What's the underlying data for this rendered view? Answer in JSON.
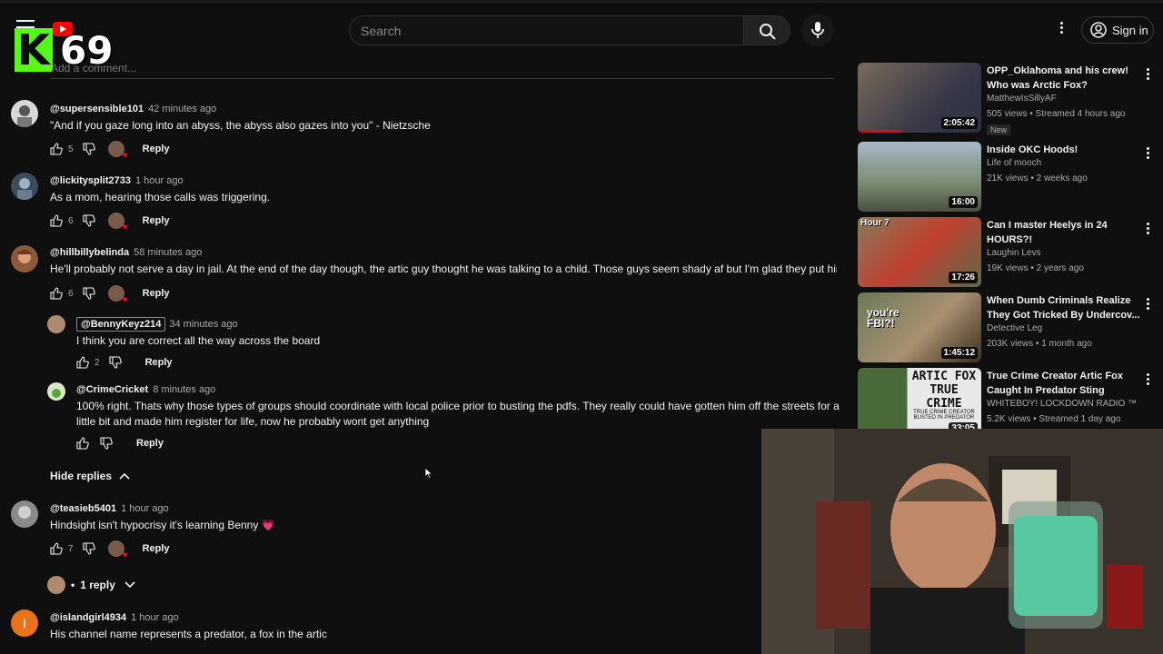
{
  "header": {
    "search_placeholder": "Search",
    "sign_in": "Sign in",
    "kick_count": "69",
    "add_comment": "Add a comment..."
  },
  "comments": [
    {
      "author": "@supersensible101",
      "time": "42 minutes ago",
      "text": "\"And if you gaze long into an abyss, the abyss also gazes into you\" - Nietzsche",
      "likes": "5",
      "reply": "Reply"
    },
    {
      "author": "@lickitysplit2733",
      "time": "1 hour ago",
      "text": "As a mom, hearing those calls was triggering.",
      "likes": "6",
      "reply": "Reply"
    },
    {
      "author": "@hillbillybelinda",
      "time": "58 minutes ago",
      "text": "He'll probably not serve a day in jail. At the end of the day though, the artic guy thought he was talking to a child. Those guys seem shady af but I'm glad they put him on blast",
      "likes": "6",
      "reply": "Reply"
    },
    {
      "author": "@teasieb5401",
      "time": "1 hour ago",
      "text": "Hindsight isn't hypocrisy it's learning Benny 💗",
      "likes": "7",
      "reply": "Reply"
    },
    {
      "author": "@islandgirl4934",
      "time": "1 hour ago",
      "text": "His channel name represents a predator, a fox in the artic",
      "avatar_letter": "I"
    }
  ],
  "replies": [
    {
      "author": "@BennyKeyz214",
      "time": "34 minutes ago",
      "text": "I think you are correct all the way across the board",
      "likes": "2",
      "reply": "Reply"
    },
    {
      "author": "@CrimeCricket",
      "time": "8 minutes ago",
      "text": "100% right. Thats why those types of groups should coordinate with local police prior to busting the pdfs. They really could have gotten him off the streets for a little bit and made him register for life, now he probably wont get anything",
      "likes": "",
      "reply": "Reply"
    }
  ],
  "hide_replies": "Hide replies",
  "one_reply": "1 reply",
  "sidebar": [
    {
      "title": "OPP_Oklahoma and his crew! Who was Arctic Fox?",
      "channel": "MatthewIsSillyAF",
      "stats": "505 views • Streamed 4 hours ago",
      "badge": "New",
      "duration": "2:05:42",
      "progress": 0.35
    },
    {
      "title": "Inside OKC Hoods!",
      "channel": "Life of mooch",
      "stats": "21K views • 2 weeks ago",
      "duration": "16:00"
    },
    {
      "title": "Can I master Heelys in 24 HOURS?!",
      "channel": "Laughin Levs",
      "stats": "19K views • 2 years ago",
      "duration": "17:26",
      "thumb_label": "Hour 7"
    },
    {
      "title": "When Dumb Criminals Realize They Got Tricked By Undercov...",
      "channel": "Detective Leg",
      "stats": "203K views • 1 month ago",
      "duration": "1:45:12",
      "thumb_label": "you're FBI?!"
    },
    {
      "title": "True Crime Creator Artic Fox Caught In Predator Sting",
      "channel": "WHITEBOY! LOCKDOWN RADIO ™",
      "stats": "5.2K views • Streamed 1 day ago",
      "duration": "33:05",
      "thumb_label": "ARTIC FOX TRUE CRIME",
      "thumb_sub": "TRUE CRIME CREATOR BUSTED IN PREDATOR"
    }
  ],
  "colors": {
    "accent": "#ff0000",
    "kick": "#53fc18",
    "bg": "#0f0f0f"
  }
}
